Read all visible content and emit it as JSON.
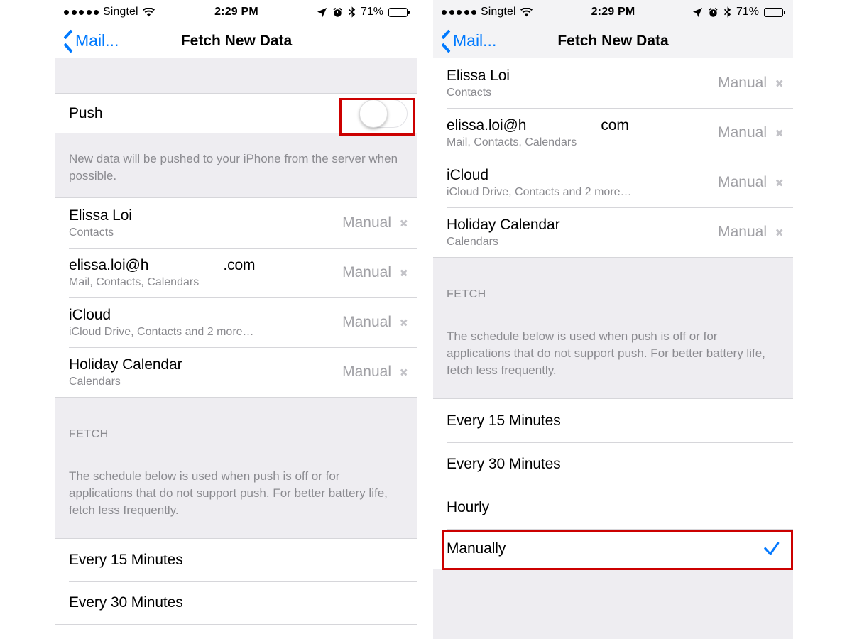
{
  "status_bar": {
    "signal_dots": 5,
    "carrier": "Singtel",
    "wifi_icon": "wifi-icon",
    "time": "2:29 PM",
    "location_icon": "location-arrow-icon",
    "alarm_icon": "alarm-clock-icon",
    "bluetooth_icon": "bluetooth-icon",
    "battery_percent": "71%",
    "battery_fill": 74
  },
  "nav": {
    "back_label": "Mail...",
    "back_icon": "chevron-left-icon",
    "title": "Fetch New Data"
  },
  "colors": {
    "accent_blue": "#007aff",
    "annotation_red": "#cc0000",
    "group_background": "#eeedf1",
    "separator": "#d6d6da",
    "secondary_text": "#8b8b90"
  },
  "left_panel": {
    "push": {
      "label": "Push",
      "toggle_state": "off",
      "highlighted": true
    },
    "push_note": "New data will be pushed to your iPhone from the server when possible.",
    "accounts": [
      {
        "title": "Elissa Loi",
        "subtitle": "Contacts",
        "value": "Manual",
        "chevron": "chevron-right-icon"
      },
      {
        "title_prefix": "elissa.loi@h",
        "title_suffix": ".com",
        "redacted": true,
        "subtitle": "Mail, Contacts, Calendars",
        "value": "Manual",
        "chevron": "chevron-right-icon"
      },
      {
        "title": "iCloud",
        "subtitle": "iCloud Drive, Contacts and 2 more…",
        "value": "Manual",
        "chevron": "chevron-right-icon"
      },
      {
        "title": "Holiday Calendar",
        "subtitle": "Calendars",
        "value": "Manual",
        "chevron": "chevron-right-icon"
      }
    ],
    "fetch_header": "FETCH",
    "fetch_note": "The schedule below is used when push is off or for applications that do not support push. For better battery life, fetch less frequently.",
    "schedule": [
      {
        "label": "Every 15 Minutes",
        "selected": false
      },
      {
        "label": "Every 30 Minutes",
        "selected": false
      }
    ]
  },
  "right_panel": {
    "accounts": [
      {
        "title": "Elissa Loi",
        "subtitle": "Contacts",
        "value": "Manual",
        "chevron": "chevron-right-icon"
      },
      {
        "title_prefix": "elissa.loi@h",
        "title_suffix": "com",
        "redacted": true,
        "subtitle": "Mail, Contacts, Calendars",
        "value": "Manual",
        "chevron": "chevron-right-icon"
      },
      {
        "title": "iCloud",
        "subtitle": "iCloud Drive, Contacts and 2 more…",
        "value": "Manual",
        "chevron": "chevron-right-icon"
      },
      {
        "title": "Holiday Calendar",
        "subtitle": "Calendars",
        "value": "Manual",
        "chevron": "chevron-right-icon"
      }
    ],
    "fetch_header": "FETCH",
    "fetch_note": "The schedule below is used when push is off or for applications that do not support push. For better battery life, fetch less frequently.",
    "schedule": [
      {
        "label": "Every 15 Minutes",
        "selected": false
      },
      {
        "label": "Every 30 Minutes",
        "selected": false
      },
      {
        "label": "Hourly",
        "selected": false
      },
      {
        "label": "Manually",
        "selected": true,
        "check_icon": "checkmark-icon",
        "highlighted": true
      }
    ]
  }
}
